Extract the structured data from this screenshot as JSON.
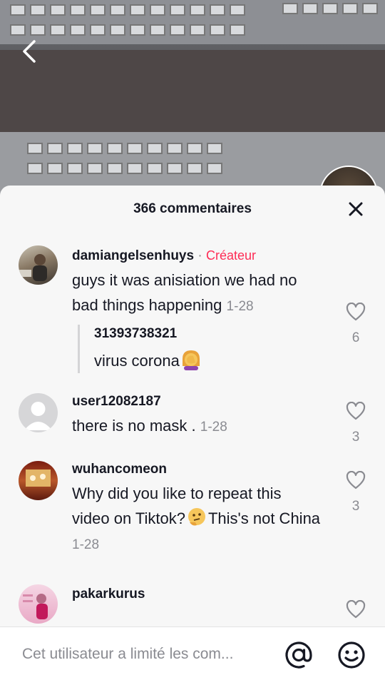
{
  "video": {
    "back_icon": "chevron-left-icon"
  },
  "sheet": {
    "title": "366 commentaires",
    "close_icon": "close-icon"
  },
  "comments": [
    {
      "username": "damiangelsenhuys",
      "separator": "·",
      "tag": "Créateur",
      "text": "guys it was anisiation we had no bad things happening",
      "date": "1-28",
      "likes": "6",
      "reply": {
        "username": "31393738321",
        "text": "virus corona",
        "emoji": "face-palm-emoji"
      }
    },
    {
      "username": "user12082187",
      "text": "there is no mask .",
      "date": "1-28",
      "likes": "3"
    },
    {
      "username": "wuhancomeon",
      "text_before": "Why did you like to repeat this video on Tiktok?",
      "emoji": "thinking-face-emoji",
      "text_after": "This's not China",
      "date": "1-28",
      "likes": "3"
    },
    {
      "username": "pakarkurus"
    }
  ],
  "bottom_bar": {
    "input_value": "Cet utilisateur a limité les com...",
    "at_icon": "at-icon",
    "emoji_icon": "smiley-icon"
  },
  "colors": {
    "accent": "#fe2c55",
    "text": "#161823",
    "muted": "#8a8b91",
    "sheet": "#f7f7f7"
  }
}
